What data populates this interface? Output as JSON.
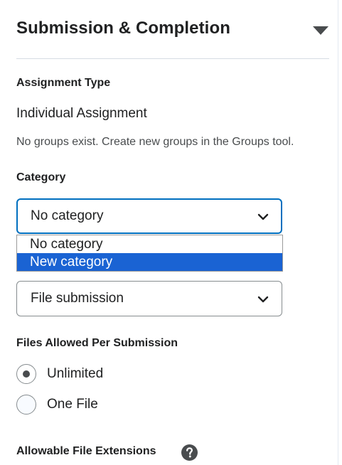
{
  "section": {
    "title": "Submission & Completion"
  },
  "assignment_type": {
    "label": "Assignment Type",
    "value": "Individual Assignment",
    "note": "No groups exist. Create new groups in the Groups tool."
  },
  "category": {
    "label": "Category",
    "selected": "No category",
    "options": [
      "No category",
      "New category"
    ],
    "highlighted_option": "New category"
  },
  "submission_type": {
    "selected": "File submission"
  },
  "files_allowed": {
    "label": "Files Allowed Per Submission",
    "options": [
      {
        "label": "Unlimited",
        "checked": true
      },
      {
        "label": "One File",
        "checked": false
      }
    ]
  },
  "file_extensions": {
    "label": "Allowable File Extensions",
    "icon": "help-circle-icon"
  },
  "colors": {
    "focus": "#006fbf",
    "highlight": "#1a63d3",
    "text": "#202122"
  }
}
